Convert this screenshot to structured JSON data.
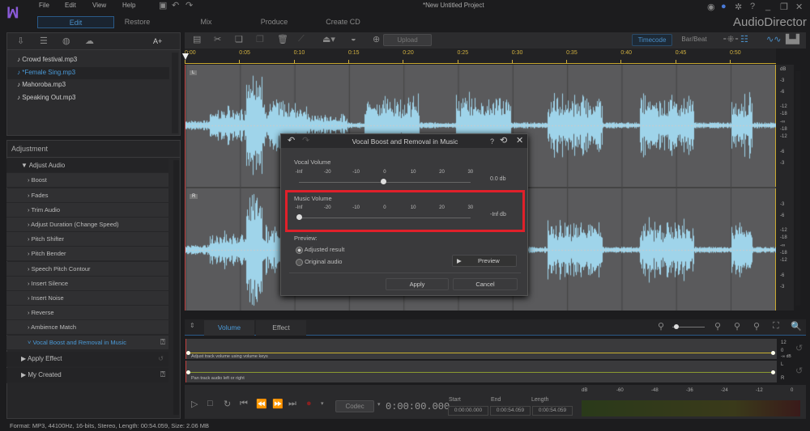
{
  "menu": [
    "File",
    "Edit",
    "View",
    "Help"
  ],
  "title": "*New Untitled Project",
  "app_name": "AudioDirector",
  "tabs": [
    "Edit",
    "Restore",
    "Mix",
    "Produce",
    "Create CD"
  ],
  "library": {
    "font_button": "A+",
    "files": [
      "Crowd festival.mp3",
      "*Female Sing.mp3",
      "Mahoroba.mp3",
      "Speaking Out.mp3"
    ]
  },
  "toolbar": {
    "upload": "Upload",
    "timecode": "Timecode",
    "barbeat": "Bar/Beat"
  },
  "ruler": [
    "0:00",
    "0:05",
    "0:10",
    "0:15",
    "0:20",
    "0:25",
    "0:30",
    "0:35",
    "0:40",
    "0:45",
    "0:50"
  ],
  "channels": [
    "L",
    "R"
  ],
  "db_scale": [
    "dB",
    "-3",
    "-6",
    "-12",
    "-18",
    "-∞",
    "-18",
    "-12",
    "-6",
    "-3"
  ],
  "adjustment": {
    "header": "Adjustment",
    "section": "Adjust Audio",
    "items": [
      "Boost",
      "Fades",
      "Trim Audio",
      "Adjust Duration (Change Speed)",
      "Pitch Shifter",
      "Pitch Bender",
      "Speech Pitch Contour",
      "Insert Silence",
      "Insert Noise",
      "Reverse",
      "Ambience Match",
      "Vocal Boost and Removal in Music"
    ],
    "apply_effect": "Apply Effect",
    "my_created": "My Created"
  },
  "dialog": {
    "title": "Vocal Boost and Removal in Music",
    "help": "?",
    "vocal_label": "Vocal Volume",
    "vocal_value": "0.0 db",
    "vocal_level": 0,
    "music_label": "Music Volume",
    "music_value": "-Inf db",
    "music_level": "-Inf",
    "scale": [
      "-Inf",
      "-20",
      "-10",
      "0",
      "10",
      "20",
      "30"
    ],
    "preview_label": "Preview:",
    "opt_adjusted": "Adjusted result",
    "opt_original": "Original audio",
    "preview_button": "Preview",
    "apply": "Apply",
    "cancel": "Cancel",
    "highlight_color": "#e0202a"
  },
  "bottom_tabs": [
    "Volume",
    "Effect"
  ],
  "envelope": {
    "volume_hint": "Adjust track volume using volume keys",
    "pan_hint": "Pan track audio left or right",
    "vol_scale": [
      "12",
      "0",
      "-∞ dB"
    ],
    "pan_scale": [
      "L",
      "R"
    ]
  },
  "transport": {
    "codec": "Codec",
    "time": "0:00:00.000",
    "start_label": "Start",
    "end_label": "End",
    "length_label": "Length",
    "start": "0:00:00.000",
    "end": "0:00:54.059",
    "length": "0:00:54.059"
  },
  "meter_scale": [
    "dB",
    "-60",
    "-48",
    "-36",
    "-24",
    "-12",
    "0"
  ],
  "status": "Format: MP3, 44100Hz, 16-bits, Stereo, Length: 00:54.059, Size: 2.06 MB"
}
